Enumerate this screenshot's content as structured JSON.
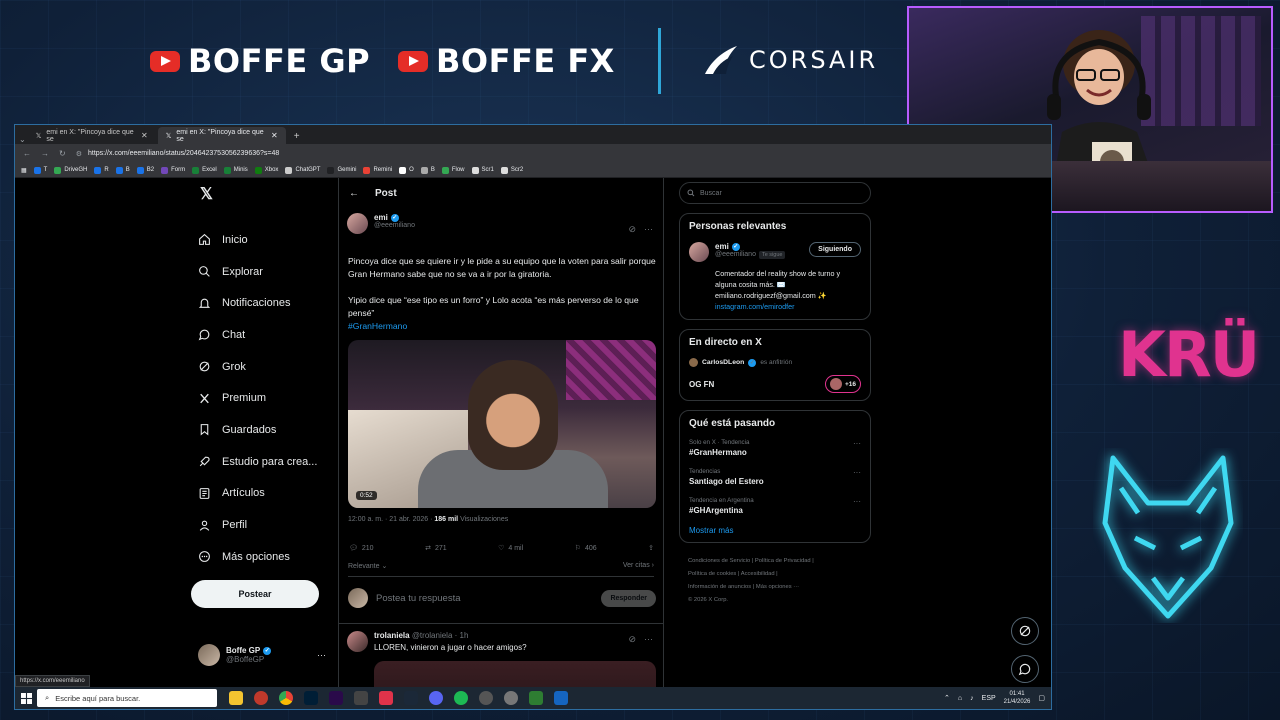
{
  "overlay": {
    "brand1": "BOFFE GP",
    "brand2": "BOFFE FX",
    "sponsor": "CORSAIR",
    "kru": "KRÜ",
    "colors": {
      "accent": "#2fa7d8",
      "webcam_border": "#b85cff",
      "kru": "#e0338f",
      "wolf": "#3fd8f0"
    }
  },
  "browser": {
    "tabs": [
      {
        "label": "emi en X: \"Pincoya dice que se"
      },
      {
        "label": "emi en X: \"Pincoya dice que se"
      }
    ],
    "new_tab": "+",
    "url": "https://x.com/eeemiliano/status/2046423753056239636?s=48",
    "bookmarks": [
      "T",
      "DriveGH",
      "R",
      "B",
      "B2",
      "Form",
      "Excel",
      "Minis",
      "Xbox",
      "ChatGPT",
      "Gemini",
      "Remini",
      "O",
      "B",
      "Flow",
      "Scr1",
      "Scr2"
    ],
    "status_url": "https://x.com/eeemiliano"
  },
  "sidebar": {
    "items": [
      {
        "label": "Inicio",
        "icon": "home-icon"
      },
      {
        "label": "Explorar",
        "icon": "search-icon"
      },
      {
        "label": "Notificaciones",
        "icon": "bell-icon"
      },
      {
        "label": "Chat",
        "icon": "chat-icon"
      },
      {
        "label": "Grok",
        "icon": "grok-icon"
      },
      {
        "label": "Premium",
        "icon": "x-premium-icon"
      },
      {
        "label": "Guardados",
        "icon": "bookmark-icon"
      },
      {
        "label": "Estudio para crea...",
        "icon": "rocket-icon"
      },
      {
        "label": "Artículos",
        "icon": "article-icon"
      },
      {
        "label": "Perfil",
        "icon": "person-icon"
      },
      {
        "label": "Más opciones",
        "icon": "more-circle-icon"
      }
    ],
    "post_button": "Postear",
    "account": {
      "name": "Boffe GP",
      "handle": "@BoffeGP"
    }
  },
  "post": {
    "header": "Post",
    "author": {
      "name": "emi",
      "handle": "@eeemiliano"
    },
    "text1": "Pincoya dice que se quiere ir y le pide a su equipo que la voten para salir porque Gran Hermano sabe que no se va a ir por la giratoria.",
    "text2": "Yipio dice que “ese tipo es un forro” y Lolo acota “es más perverso de lo que pensé”",
    "hashtag": "#GranHermano",
    "video_duration": "0:52",
    "time": "12:00 a. m. · 21 abr. 2026 · ",
    "views_count": "186 mil",
    "views_label": " Visualizaciones",
    "replies": "210",
    "reposts": "271",
    "likes": "4 mil",
    "bookmarks": "406",
    "sort": "Relevante",
    "quotes": "Ver citas",
    "reply_placeholder": "Postea tu respuesta",
    "reply_button": "Responder"
  },
  "reply_tweet": {
    "name": "trolaniela",
    "meta": "@trolaniela · 1h",
    "text": "LLOREN, vinieron a jugar o hacer amigos?"
  },
  "right": {
    "search_placeholder": "Buscar",
    "relevant": {
      "title": "Personas relevantes",
      "name": "emi",
      "handle": "@eeemiliano",
      "follows_you": "Te sigue",
      "follow_button": "Siguiendo",
      "bio": "Comentador del reality show de turno y alguna cosita más. ✉️ emiliano.rodriguezf@gmail.com ✨",
      "link": "instagram.com/emirodfer"
    },
    "live": {
      "title": "En directo en X",
      "host": "CarlosDLeon",
      "host_suffix": "es anfitrión",
      "stream": "OG FN",
      "count": "+16"
    },
    "trends": {
      "title": "Qué está pasando",
      "items": [
        {
          "category": "Solo en X · Tendencia",
          "name": "#GranHermano"
        },
        {
          "category": "Tendencias",
          "name": "Santiago del Estero"
        },
        {
          "category": "Tendencia en Argentina",
          "name": "#GHArgentina"
        }
      ],
      "show_more": "Mostrar más"
    },
    "footer": {
      "line1": "Condiciones de Servicio  |  Política de Privacidad  |",
      "line2": "Política de cookies  |  Accesibilidad  |",
      "line3": "Información de anuncios  |  Más opciones ···",
      "line4": "© 2026 X Corp."
    }
  },
  "taskbar": {
    "search": "Escribe aquí para buscar.",
    "lang": "ESP",
    "time": "01:41",
    "date": "21/4/2026"
  }
}
